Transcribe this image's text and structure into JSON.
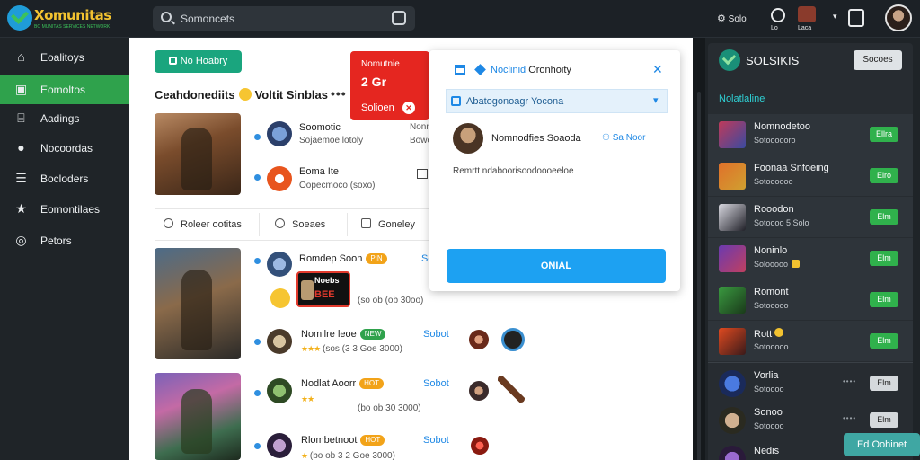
{
  "brand": {
    "name": "Xomunitas",
    "tagline": "BO MUNITAS SERVICES NETWORK"
  },
  "search": {
    "placeholder": "Somoncets"
  },
  "topbar": {
    "item1": "Solo",
    "item2": "Lo",
    "item3": "Laca"
  },
  "sidebar": {
    "items": [
      {
        "label": "Eoalitoys",
        "icon": "home-icon",
        "active": false
      },
      {
        "label": "Eomoltos",
        "icon": "grid-icon",
        "active": true
      },
      {
        "label": "Aadings",
        "icon": "store-icon",
        "active": false
      },
      {
        "label": "Nocoordas",
        "icon": "users-icon",
        "active": false
      },
      {
        "label": "Bocloders",
        "icon": "list-icon",
        "active": false
      },
      {
        "label": "Eomontilaes",
        "icon": "star-icon",
        "active": false
      },
      {
        "label": "Petors",
        "icon": "settings-icon",
        "active": false
      }
    ]
  },
  "main": {
    "new_button": "No Hoabry",
    "feed_title": "Ceahdonediits",
    "feed_title_2": "Voltit Sinblas",
    "posts_top": [
      {
        "name": "Soomotic",
        "name_right": "Nonmtor",
        "meta": "Sojaemoe lotoly",
        "meta_right": "Bowoaitrs"
      },
      {
        "name": "Eoma Ite",
        "meta": "Oopecmoco (soxo)"
      }
    ],
    "tabs": [
      {
        "label": "Roleer ootitas",
        "icon": "chat-icon"
      },
      {
        "label": "Soeaes",
        "icon": "comment-icon"
      },
      {
        "label": "Goneley",
        "icon": "share-icon"
      }
    ],
    "posts": [
      {
        "name": "Romdep Soon",
        "meta": "(so ob (ob 30oo)",
        "link": "Sobot",
        "tag": "PIN"
      },
      {
        "name": "Nomilre leoe",
        "meta": "(sos (3 3 Goe 3000)",
        "link": "Sobot",
        "tag": "NEW"
      },
      {
        "name": "Nodlat Aoorr",
        "meta": "(bo ob 30 3000)",
        "link": "Sobot",
        "tag": "HOT"
      },
      {
        "name": "Rlombetnoot",
        "meta": "(bo ob 3 2 Goe 3000)",
        "link": "Sobot",
        "tag": "HOT"
      }
    ],
    "badge": {
      "title": "Noebs",
      "sub": "BEE"
    }
  },
  "red_popup": {
    "line1": "Nomutnie",
    "line2": "2 Gr",
    "line3": "Solioen"
  },
  "card": {
    "title_blue": "Noclinid",
    "title": "Oronhoity",
    "select_label": "Abatogonoagr Yocona",
    "user_name": "Nomnodfies Soaoda",
    "follow": "Sa Noor",
    "description": "Remrtt ndaboorisoodoooeeloe",
    "button": "ONIAL"
  },
  "right_panel": {
    "title": "SOLSIKIS",
    "top_button": "Socoes",
    "section": "Nolatlaline",
    "items": [
      {
        "name": "Nomnodetoo",
        "meta": "Sotoooooro",
        "button": "Ellra",
        "btn_style": "green"
      },
      {
        "name": "Foonaa Snfoeing",
        "meta": "Sotoooooo",
        "button": "Elro",
        "btn_style": "green"
      },
      {
        "name": "Rooodon",
        "meta": "Sotoooo 5 Solo",
        "button": "Elm",
        "btn_style": "green"
      },
      {
        "name": "Noninlo",
        "meta": "Solooooo",
        "button": "Elm",
        "btn_style": "green"
      },
      {
        "name": "Romont",
        "meta": "Sotooooo",
        "button": "Elm",
        "btn_style": "green"
      },
      {
        "name": "Rott",
        "meta": "Sotooooo",
        "button": "Elm",
        "btn_style": "green"
      },
      {
        "name": "Vorlia",
        "meta": "Sotoooo",
        "button": "Elm",
        "btn_style": "grey"
      },
      {
        "name": "Sonoo",
        "meta": "Sotoooo",
        "button": "Elm",
        "btn_style": "grey"
      },
      {
        "name": "Nedis",
        "meta": "",
        "button": "",
        "btn_style": "grey"
      }
    ]
  },
  "chat_button": "Ed Oohinet",
  "colors": {
    "accent_green": "#2fa24c",
    "accent_blue": "#1da1f2",
    "alert_red": "#e52620"
  }
}
